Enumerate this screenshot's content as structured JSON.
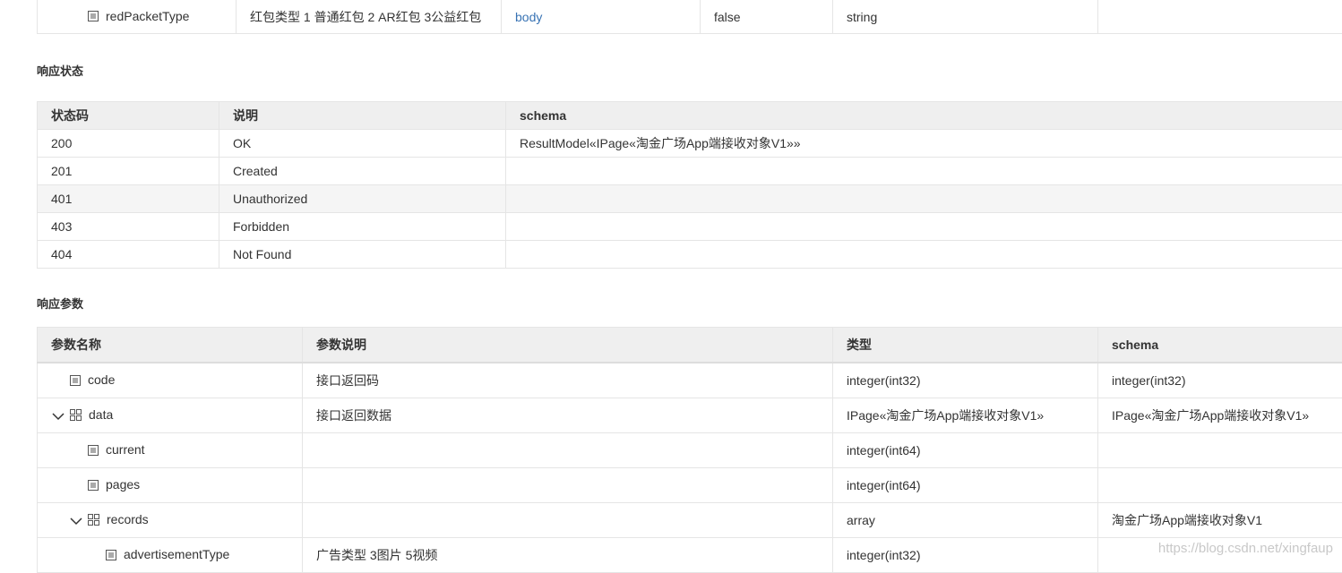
{
  "request_params": {
    "rows": [
      {
        "name": "redPacketType",
        "desc": "红包类型 1 普通红包 2 AR红包 3公益红包",
        "in": "body",
        "required": "false",
        "type": "string",
        "schema": ""
      }
    ]
  },
  "response_status": {
    "title": "响应状态",
    "headers": [
      "状态码",
      "说明",
      "schema"
    ],
    "rows": [
      {
        "code": "200",
        "desc": "OK",
        "schema": "ResultModel«IPage«淘金广场App端接收对象V1»»"
      },
      {
        "code": "201",
        "desc": "Created",
        "schema": ""
      },
      {
        "code": "401",
        "desc": "Unauthorized",
        "schema": ""
      },
      {
        "code": "403",
        "desc": "Forbidden",
        "schema": ""
      },
      {
        "code": "404",
        "desc": "Not Found",
        "schema": ""
      }
    ]
  },
  "response_params": {
    "title": "响应参数",
    "headers": [
      "参数名称",
      "参数说明",
      "类型",
      "schema"
    ],
    "rows": [
      {
        "name": "code",
        "desc": "接口返回码",
        "type": "integer(int32)",
        "schema": "integer(int32)"
      },
      {
        "name": "data",
        "desc": "接口返回数据",
        "type": "IPage«淘金广场App端接收对象V1»",
        "schema": "IPage«淘金广场App端接收对象V1»"
      },
      {
        "name": "current",
        "desc": "",
        "type": "integer(int64)",
        "schema": ""
      },
      {
        "name": "pages",
        "desc": "",
        "type": "integer(int64)",
        "schema": ""
      },
      {
        "name": "records",
        "desc": "",
        "type": "array",
        "schema": "淘金广场App端接收对象V1"
      },
      {
        "name": "advertisementType",
        "desc": "广告类型 3图片 5视频",
        "type": "integer(int32)",
        "schema": ""
      }
    ]
  },
  "watermark": "https://blog.csdn.net/xingfaup",
  "colors": {
    "link": "#3873b4",
    "header_bg": "#efefef",
    "border": "#e5e5e5",
    "alt_row": "#f5f5f5"
  }
}
